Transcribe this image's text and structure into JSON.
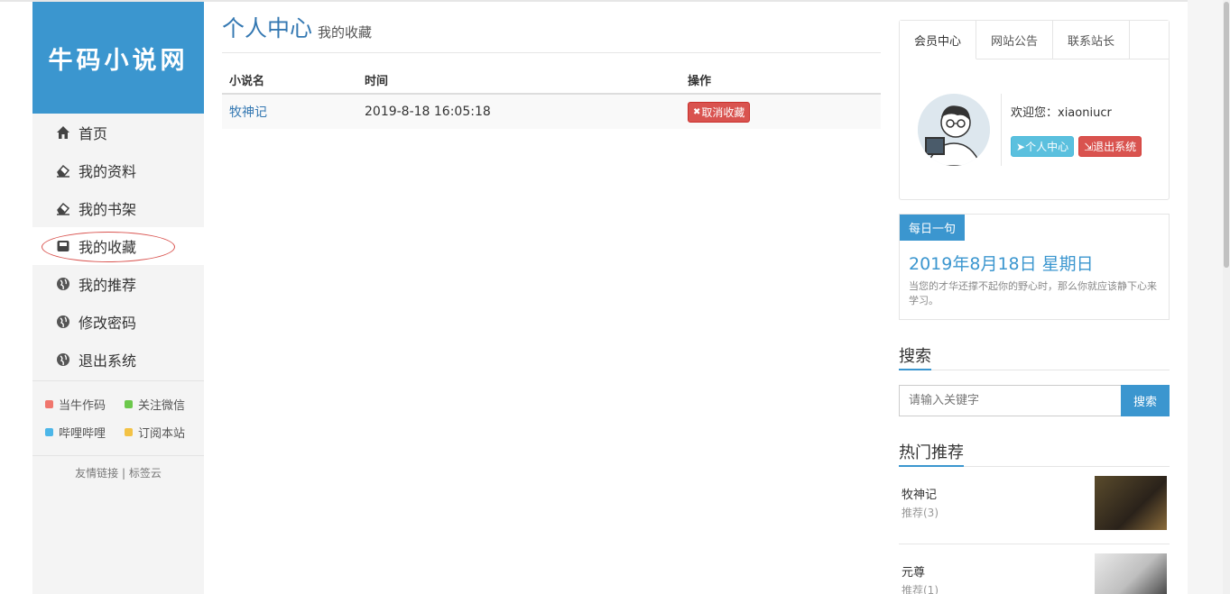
{
  "logo": {
    "text": "牛码小说网"
  },
  "sidebar": {
    "items": [
      {
        "label": "首页",
        "icon": "home-icon"
      },
      {
        "label": "我的资料",
        "icon": "eraser-icon"
      },
      {
        "label": "我的书架",
        "icon": "eraser-icon"
      },
      {
        "label": "我的收藏",
        "icon": "inbox-icon"
      },
      {
        "label": "我的推荐",
        "icon": "globe-icon"
      },
      {
        "label": "修改密码",
        "icon": "globe-icon"
      },
      {
        "label": "退出系统",
        "icon": "globe-icon"
      }
    ],
    "tags": [
      {
        "label": "当牛作码",
        "color": "#f0766d"
      },
      {
        "label": "关注微信",
        "color": "#6cc84c"
      },
      {
        "label": "哔哩哔哩",
        "color": "#4cb6e8"
      },
      {
        "label": "订阅本站",
        "color": "#f3c245"
      }
    ],
    "links": {
      "friend": "友情链接",
      "sep": "|",
      "tags": "标签云"
    }
  },
  "main": {
    "title": "个人中心",
    "subtitle": "我的收藏",
    "table": {
      "headers": [
        "小说名",
        "时间",
        "操作"
      ],
      "rows": [
        {
          "name": "牧神记",
          "time": "2019-8-18 16:05:18",
          "action": "取消收藏"
        }
      ]
    }
  },
  "right": {
    "tabs": [
      "会员中心",
      "网站公告",
      "联系站长"
    ],
    "welcome": "欢迎您：xiaoniucr",
    "btn_center": "个人中心",
    "btn_logout": "退出系统",
    "quote_label": "每日一句",
    "quote_date": "2019年8月18日 星期日",
    "quote_text": "当您的才华还撑不起你的野心时，那么你就应该静下心来学习。",
    "search_title": "搜索",
    "search_placeholder": "请输入关键字",
    "search_button": "搜索",
    "hot_title": "热门推荐",
    "hot": [
      {
        "name": "牧神记",
        "sub": "推荐(3)"
      },
      {
        "name": "元尊",
        "sub": "推荐(1)"
      }
    ]
  }
}
